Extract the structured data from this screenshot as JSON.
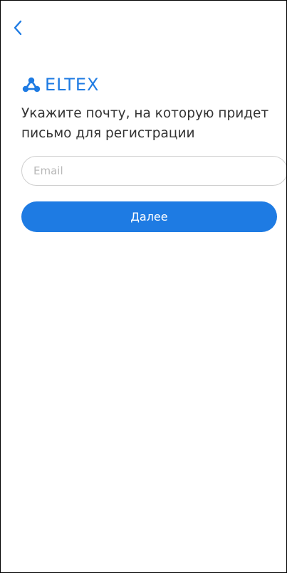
{
  "header": {
    "back_icon": "chevron-left-icon"
  },
  "brand": {
    "logo_icon": "eltex-nodes-icon",
    "name": "ELTEX"
  },
  "form": {
    "prompt": "Укажите почту, на которую придет письмо для регистрации",
    "email_value": "",
    "email_placeholder": "Email",
    "submit_label": "Далее"
  },
  "colors": {
    "accent": "#1e7be3",
    "text": "#333333",
    "border": "#cfcfcf",
    "placeholder": "#b8b8b8"
  }
}
